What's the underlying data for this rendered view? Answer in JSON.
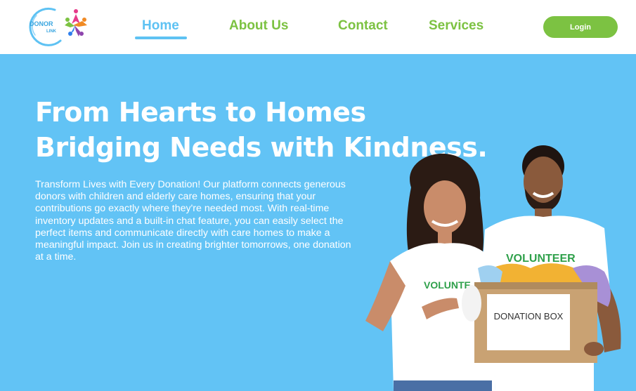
{
  "brand": {
    "logo_top": "DONOR",
    "logo_bottom": "LINK"
  },
  "nav": {
    "items": [
      {
        "label": "Home",
        "active": true
      },
      {
        "label": "About Us",
        "active": false
      },
      {
        "label": "Contact",
        "active": false
      },
      {
        "label": "Services",
        "active": false
      }
    ],
    "login_label": "Login"
  },
  "hero": {
    "headline_line1": "From Hearts to Homes",
    "headline_line2": "Bridging Needs with Kindness.",
    "description": "Transform Lives with Every Donation! Our platform connects generous donors with children and elderly care homes, ensuring that your contributions go exactly where they're needed most. With real-time inventory updates and a built-in chat feature, you can easily select the perfect items and communicate directly with care homes to make a meaningful impact. Join us in creating brighter tomorrows, one donation at a time.",
    "image": {
      "shirt_text_woman": "VOLUNTE",
      "shirt_text_man": "VOLUNTEER",
      "box_label": "DONATION BOX"
    }
  },
  "colors": {
    "accent_green": "#7cc242",
    "accent_blue": "#5ec2f3",
    "hero_background": "#62c3f5"
  }
}
